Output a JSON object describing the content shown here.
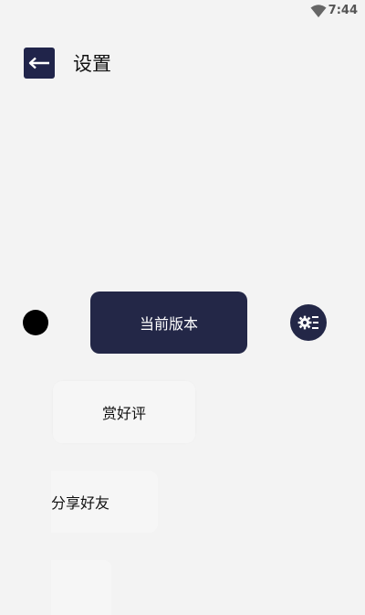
{
  "status_bar": {
    "time": "7:44",
    "wifi_icon": "wifi-icon"
  },
  "header": {
    "title": "设置",
    "back_icon": "arrow-left-icon"
  },
  "menu": {
    "version_label": "当前版本",
    "rate_label": "赏好评",
    "share_label": "分享好友",
    "settings_icon": "gear-list-icon"
  },
  "colors": {
    "primary": "#232747",
    "background": "#f3f3f3",
    "card": "#f6f6f6"
  }
}
